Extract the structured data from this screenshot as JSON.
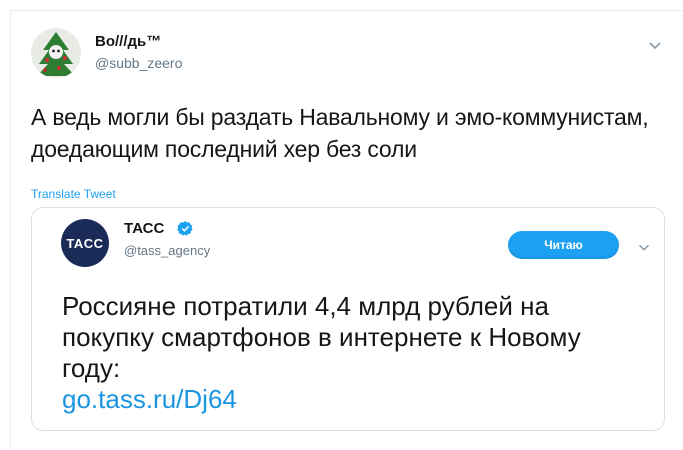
{
  "tweet": {
    "author_name": "Во///дь™",
    "author_handle": "@subb_zeero",
    "text": "А ведь могли бы раздать Навальному и эмо-коммунистам, доедающим последний хер без соли",
    "translate_label": "Translate Tweet",
    "menu_icon": "chevron-down-icon"
  },
  "quoted": {
    "avatar_text": "TACC",
    "author_name": "ТАСС",
    "verified_icon": "verified-badge-icon",
    "author_handle": "@tass_agency",
    "follow_label": "Читаю",
    "text": "Россияне потратили 4,4 млрд рублей на покупку смартфонов в интернете к Новому году:",
    "link": "go.tass.ru/Dj64"
  },
  "colors": {
    "accent": "#1da1f2",
    "link": "#1b95e0",
    "text": "#14171a",
    "secondary": "#657786",
    "border": "#d8e0e6"
  }
}
